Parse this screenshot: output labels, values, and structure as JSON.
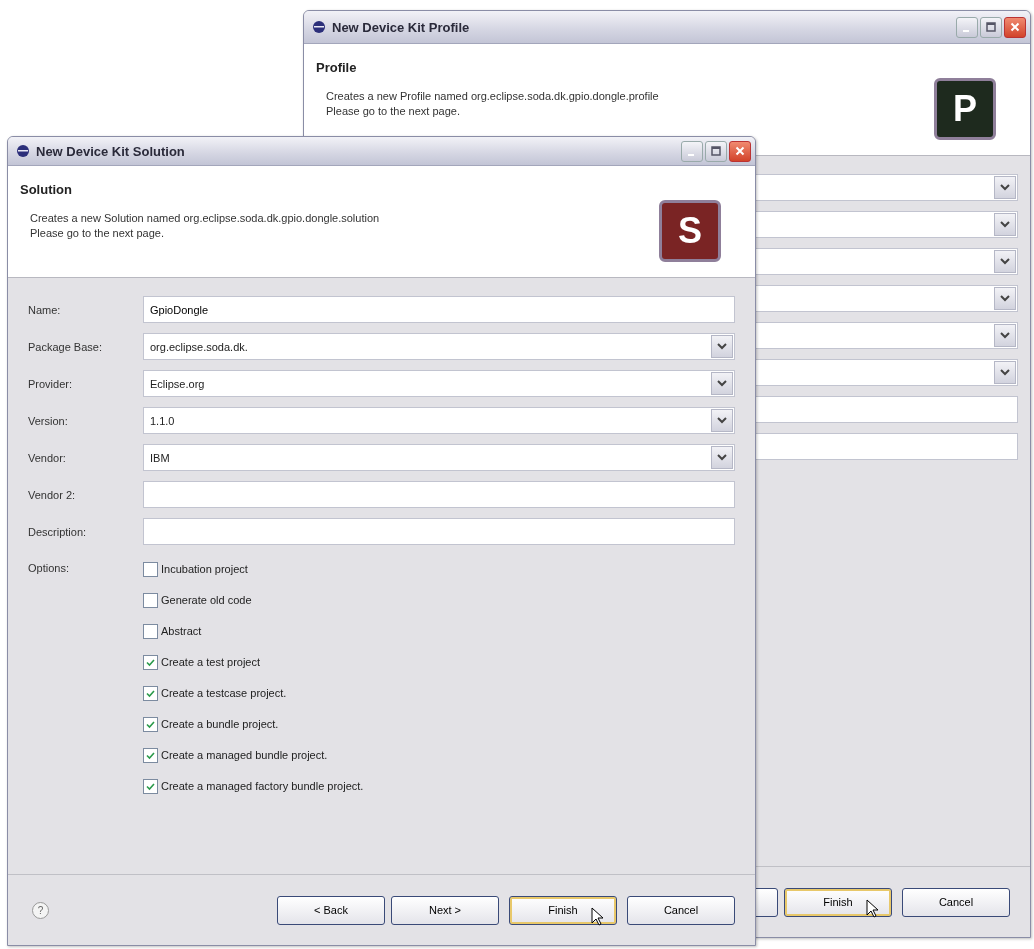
{
  "windows": [
    {
      "kind": "profile",
      "title": "New Device Kit Profile",
      "heading": "Profile",
      "description": [
        "Creates a new Profile named org.eclipse.soda.dk.gpio.dongle.profile",
        "Please go to the next page."
      ],
      "logo": "P",
      "color": "#1e2a1e",
      "fields": [
        {
          "kind": "combo"
        },
        {
          "kind": "combo"
        },
        {
          "kind": "combo"
        },
        {
          "kind": "combo"
        },
        {
          "kind": "combo"
        },
        {
          "kind": "combo"
        },
        {
          "kind": "text"
        },
        {
          "kind": "text"
        }
      ],
      "buttons": [
        {
          "kind": "blank",
          "default": false,
          "hovered": false
        },
        {
          "kind": "text",
          "label": "Finish",
          "default": true,
          "hovered": true
        },
        {
          "kind": "text",
          "label": "Cancel",
          "default": false,
          "hovered": false
        }
      ]
    },
    {
      "kind": "solution",
      "title": "New Device Kit Solution",
      "heading": "Solution",
      "description": [
        "Creates a new Solution named org.eclipse.soda.dk.gpio.dongle.solution",
        "Please go to the next page."
      ],
      "logo": "S",
      "color": "#7a2424",
      "fields": [
        {
          "kind": "text",
          "label": "Name:",
          "value": "GpioDongle"
        },
        {
          "kind": "combo",
          "label": "Package Base:",
          "value": "org.eclipse.soda.dk."
        },
        {
          "kind": "combo",
          "label": "Provider:",
          "value": "Eclipse.org"
        },
        {
          "kind": "combo",
          "label": "Version:",
          "value": "1.1.0"
        },
        {
          "kind": "combo",
          "label": "Vendor:",
          "value": "IBM"
        },
        {
          "kind": "text",
          "label": "Vendor 2:"
        },
        {
          "kind": "text",
          "label": "Description:"
        }
      ],
      "options_label": "Options:",
      "options": [
        {
          "label": "Incubation project",
          "checked": false
        },
        {
          "label": "Generate old code",
          "checked": false
        },
        {
          "label": "Abstract",
          "checked": false
        },
        {
          "label": "Create a test project",
          "checked": true
        },
        {
          "label": "Create a testcase project.",
          "checked": true
        },
        {
          "label": "Create a bundle project.",
          "checked": true
        },
        {
          "label": "Create a managed bundle project.",
          "checked": true
        },
        {
          "label": "Create a managed factory bundle project.",
          "checked": true
        }
      ],
      "help": "?",
      "buttons": [
        {
          "kind": "text",
          "label": "< Back",
          "default": false,
          "hovered": false
        },
        {
          "kind": "text",
          "label": "Next >",
          "default": false,
          "hovered": false
        },
        {
          "kind": "text",
          "label": "Finish",
          "default": true,
          "hovered": true
        },
        {
          "kind": "text",
          "label": "Cancel",
          "default": false,
          "hovered": false
        }
      ]
    }
  ]
}
